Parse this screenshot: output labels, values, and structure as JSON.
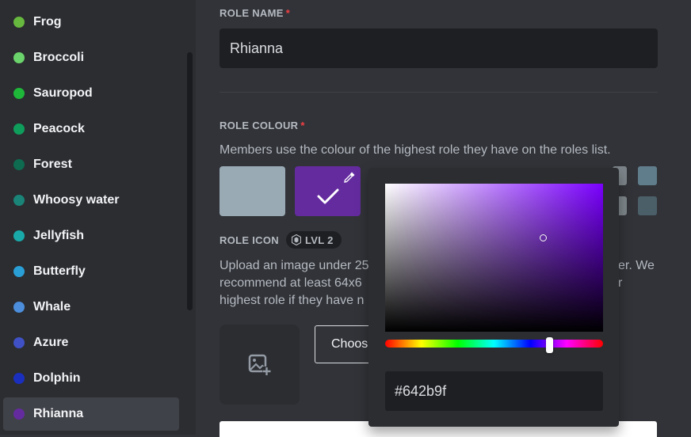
{
  "sidebar": {
    "roles": [
      {
        "label": "Frog",
        "color": "#67b83e"
      },
      {
        "label": "Broccoli",
        "color": "#6bd36b"
      },
      {
        "label": "Sauropod",
        "color": "#1fb73a"
      },
      {
        "label": "Peacock",
        "color": "#0f9d5b"
      },
      {
        "label": "Forest",
        "color": "#0e6b50"
      },
      {
        "label": "Whoosy water",
        "color": "#1a8478"
      },
      {
        "label": "Jellyfish",
        "color": "#1aa9a9"
      },
      {
        "label": "Butterfly",
        "color": "#2a9fd6"
      },
      {
        "label": "Whale",
        "color": "#4c8edb"
      },
      {
        "label": "Azure",
        "color": "#3f51c4"
      },
      {
        "label": "Dolphin",
        "color": "#1b2fbf"
      },
      {
        "label": "Rhianna",
        "color": "#642b9f"
      }
    ]
  },
  "role_name": {
    "label": "ROLE NAME",
    "required": "*",
    "value": "Rhianna"
  },
  "role_colour": {
    "label": "ROLE COLOUR",
    "required": "*",
    "description": "Members use the colour of the highest role they have on the roles list.",
    "default_color": "#99aab5",
    "custom_color": "#642b9f",
    "small_swatches_visible": [
      "#607d8b",
      "#4b5f69",
      "#7d858a",
      "#4c5f69"
    ]
  },
  "role_icon": {
    "label": "ROLE ICON",
    "level_badge": "LVL 2",
    "description_line1": "Upload an image under 25",
    "description_line1_end": "er. We",
    "description_line2": "recommend at least 64x6",
    "description_line2_end": "r",
    "description_line3": "highest role if they have n",
    "choose_button_label": "Choose"
  },
  "color_picker": {
    "hex_value": "#642b9f",
    "hue_color": "#7a00ff"
  }
}
